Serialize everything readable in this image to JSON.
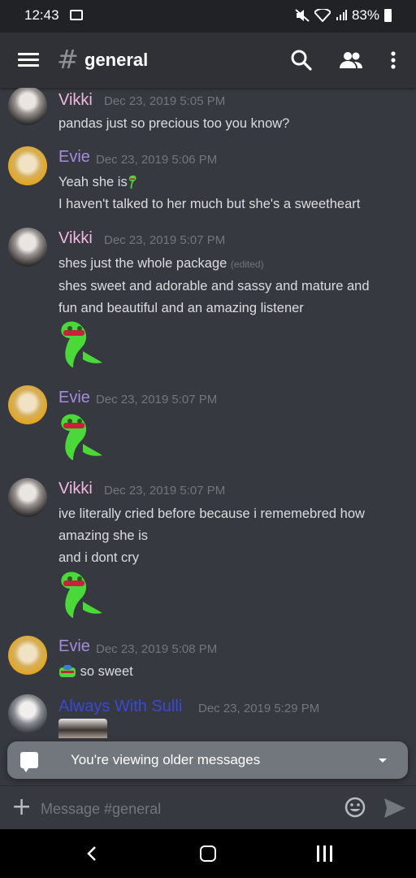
{
  "status": {
    "time": "12:43",
    "battery": "83%"
  },
  "toolbar": {
    "hash": "#",
    "channel": "general"
  },
  "messages": [
    {
      "author": "Vikki",
      "timestamp": "Dec 23, 2019 5:05 PM",
      "lines": [
        "pandas just so precious too you know?"
      ]
    },
    {
      "author": "Evie",
      "timestamp": "Dec 23, 2019 5:06 PM",
      "lines": [
        "Yeah she is",
        "I haven't talked to her much but she's a sweetheart"
      ]
    },
    {
      "author": "Vikki",
      "timestamp": "Dec 23, 2019 5:07 PM",
      "lines": [
        "shes just the whole package",
        "shes sweet and adorable and sassy and mature and",
        "fun and beautiful and an amazing listener"
      ],
      "edited": "(edited)"
    },
    {
      "author": "Evie",
      "timestamp": "Dec 23, 2019 5:07 PM",
      "lines": []
    },
    {
      "author": "Vikki",
      "timestamp": "Dec 23, 2019 5:07 PM",
      "lines": [
        "ive literally cried before because i rememebred how",
        "amazing she is",
        "and i dont cry"
      ]
    },
    {
      "author": "Evie",
      "timestamp": "Dec 23, 2019 5:08 PM",
      "lines": [
        "so sweet"
      ]
    },
    {
      "author": "Always With Sulli",
      "timestamp": "Dec 23, 2019 5:29 PM",
      "lines": []
    }
  ],
  "banner": {
    "text": "You're viewing older messages"
  },
  "composer": {
    "placeholder": "Message #general",
    "plus": "+"
  },
  "icons": [
    "menu-icon",
    "search-icon",
    "members-icon",
    "more-vert-icon",
    "emoji-icon",
    "send-icon",
    "back-icon",
    "home-icon",
    "recent-apps-icon"
  ]
}
